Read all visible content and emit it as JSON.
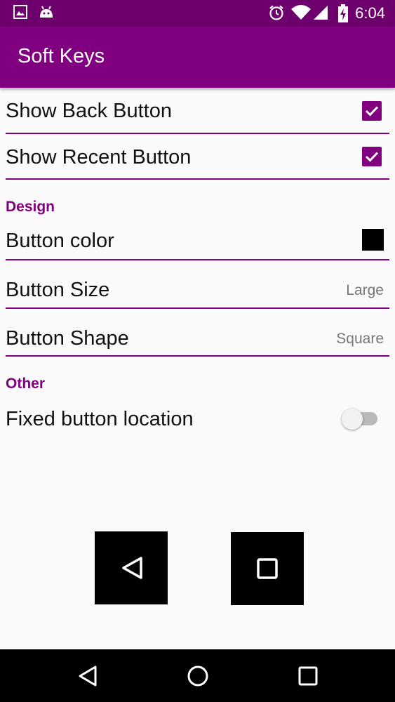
{
  "status_bar": {
    "time": "6:04",
    "icons": [
      "image-notification-icon",
      "android-notification-icon",
      "alarm-icon",
      "wifi-icon",
      "signal-icon",
      "battery-charging-icon"
    ]
  },
  "app_bar": {
    "title": "Soft Keys"
  },
  "preferences": {
    "show_back": {
      "label": "Show Back Button",
      "checked": true
    },
    "show_recent": {
      "label": "Show Recent Button",
      "checked": true
    },
    "design_category": "Design",
    "button_color": {
      "label": "Button color",
      "value_color": "#000000"
    },
    "button_size": {
      "label": "Button Size",
      "value": "Large"
    },
    "button_shape": {
      "label": "Button Shape",
      "value": "Square"
    },
    "other_category": "Other",
    "fixed_location": {
      "label": "Fixed button location",
      "enabled": false
    }
  },
  "preview": {
    "keys": [
      "back-icon",
      "recent-apps-icon"
    ],
    "key_color": "#000000"
  },
  "nav_bar": {
    "buttons": [
      "back-icon",
      "home-icon",
      "recents-icon"
    ]
  },
  "colors": {
    "accent": "#800080",
    "status_bar": "#6d006d",
    "background": "#fafafa"
  }
}
